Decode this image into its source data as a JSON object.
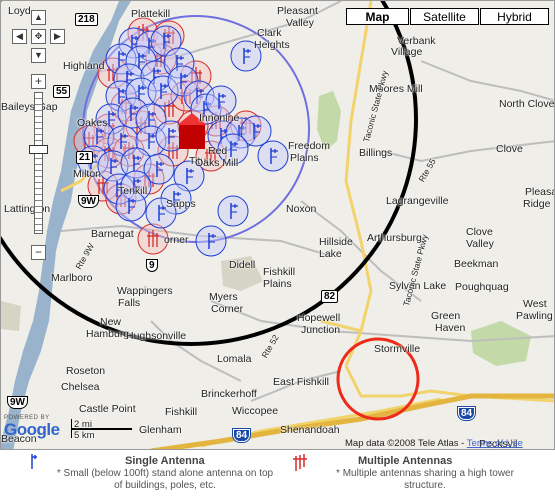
{
  "map_type": {
    "options": [
      "Map",
      "Satellite",
      "Hybrid"
    ],
    "selected": "Map"
  },
  "zoom": {
    "plus": "+",
    "minus": "−"
  },
  "places": [
    {
      "name": "Loyd"
    },
    {
      "name": "Plattekill"
    },
    {
      "name": "Pleasant"
    },
    {
      "name": "Valley"
    },
    {
      "name": "Clark"
    },
    {
      "name": "Heights"
    },
    {
      "name": "Highland"
    },
    {
      "name": "Verbank"
    },
    {
      "name": "Village"
    },
    {
      "name": "Moores Mill"
    },
    {
      "name": "Baileys Gap"
    },
    {
      "name": "North Clove"
    },
    {
      "name": "Oakes"
    },
    {
      "name": "Freedom"
    },
    {
      "name": "Plains"
    },
    {
      "name": "Billings"
    },
    {
      "name": "Clove"
    },
    {
      "name": "Titu"
    },
    {
      "name": "Red"
    },
    {
      "name": "Oaks Mill"
    },
    {
      "name": "Milton"
    },
    {
      "name": "Lagrangeville"
    },
    {
      "name": "Pleasa"
    },
    {
      "name": "Ridge"
    },
    {
      "name": "Noxon"
    },
    {
      "name": "Lattington"
    },
    {
      "name": "Barnegat"
    },
    {
      "name": "Arthursburg"
    },
    {
      "name": "Clove"
    },
    {
      "name": "Valley"
    },
    {
      "name": "Hillside"
    },
    {
      "name": "Lake"
    },
    {
      "name": "Marlboro"
    },
    {
      "name": "Didell"
    },
    {
      "name": "Beekman"
    },
    {
      "name": "Wappingers"
    },
    {
      "name": "Falls"
    },
    {
      "name": "Fishkill"
    },
    {
      "name": "Plains"
    },
    {
      "name": "Sylvan Lake"
    },
    {
      "name": "Poughquag"
    },
    {
      "name": "West"
    },
    {
      "name": "Pawling"
    },
    {
      "name": "Myers"
    },
    {
      "name": "Corner"
    },
    {
      "name": "Hopewell"
    },
    {
      "name": "Junction"
    },
    {
      "name": "Green"
    },
    {
      "name": "Haven"
    },
    {
      "name": "New"
    },
    {
      "name": "Hamburg"
    },
    {
      "name": "Hughsonville"
    },
    {
      "name": "Stormville"
    },
    {
      "name": "Lomala"
    },
    {
      "name": "Roseton"
    },
    {
      "name": "East Fishkill"
    },
    {
      "name": "Chelsea"
    },
    {
      "name": "Brinckerhoff"
    },
    {
      "name": "Castle Point"
    },
    {
      "name": "Fishkill"
    },
    {
      "name": "Wiccopee"
    },
    {
      "name": "Glenham"
    },
    {
      "name": "Shenandoah"
    },
    {
      "name": "Beacon"
    },
    {
      "name": "Pecksvil"
    },
    {
      "name": "Rte 9W"
    },
    {
      "name": "Rte 52"
    },
    {
      "name": "Taconic State Pkwy"
    },
    {
      "name": "Taconic State Pkwy"
    },
    {
      "name": "Rte 55"
    },
    {
      "name": "Tenkill"
    },
    {
      "name": "Sapps"
    },
    {
      "name": "orner"
    },
    {
      "name": "Innonine"
    }
  ],
  "shields": [
    {
      "text": "218",
      "kind": "state"
    },
    {
      "text": "55",
      "kind": "state"
    },
    {
      "text": "21",
      "kind": "state"
    },
    {
      "text": "9W",
      "kind": "us"
    },
    {
      "text": "9",
      "kind": "us"
    },
    {
      "text": "82",
      "kind": "state"
    },
    {
      "text": "84",
      "kind": "interstate"
    },
    {
      "text": "84",
      "kind": "interstate"
    },
    {
      "text": "9W",
      "kind": "us"
    }
  ],
  "scale": {
    "miles": "2 mi",
    "km": "5 km"
  },
  "attribution": {
    "powered": "POWERED BY",
    "logo": "Google",
    "copyright": "Map data ©2008 Tele Atlas -",
    "terms": "Terms of Use"
  },
  "legend": {
    "single_title": "Single Antenna",
    "single_text": "* Small (below 100ft) stand alone antenna on top of buildings, poles, etc.",
    "multiple_title": "Multiple Antennas",
    "multiple_text": "* Multiple antennas sharing a high tower structure."
  },
  "colors": {
    "single": "#1f3fd6",
    "multiple": "#d62b2b",
    "coverage_ring": "#000000",
    "inner_ring": "#6f6fe0",
    "highlight_ring": "#ee2b1a",
    "interstate_road": "#f2c14b",
    "water": "#99b3cc",
    "park": "#c3d9a7"
  },
  "markers": {
    "single_count": 40,
    "multiple_count": 22,
    "tower": "red building icon"
  }
}
